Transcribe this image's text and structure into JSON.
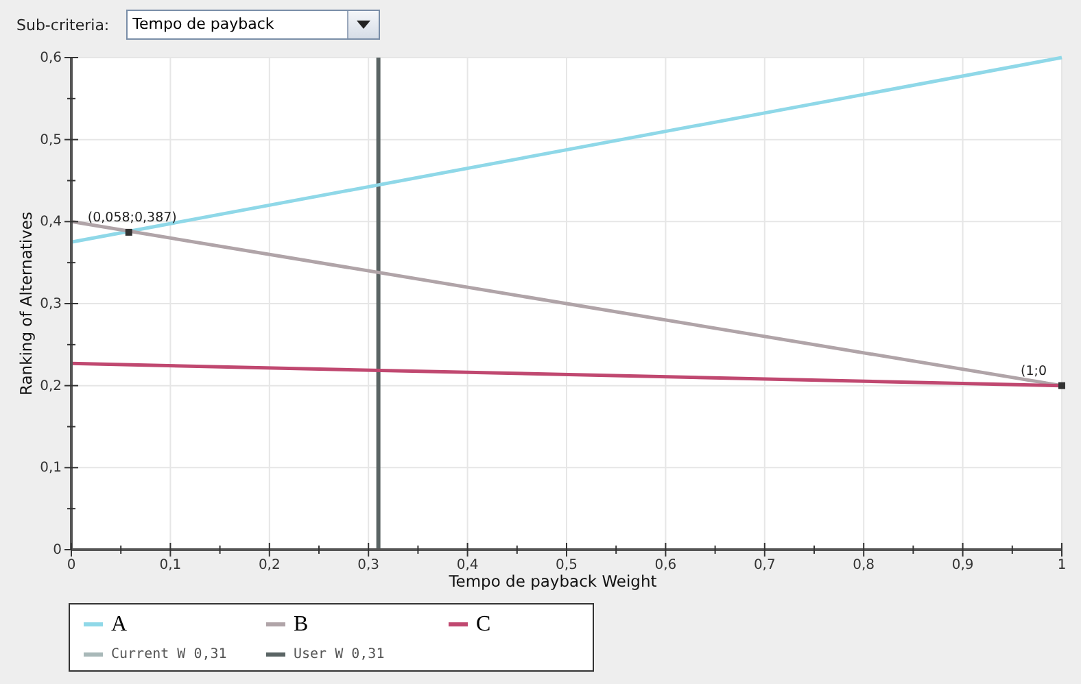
{
  "sub_criteria": {
    "label": "Sub-criteria:",
    "value": "Tempo de payback"
  },
  "chart": {
    "chart_data": {
      "type": "line",
      "xlabel": "Tempo de payback Weight",
      "ylabel": "Ranking of Alternatives",
      "xlim": [
        0,
        1
      ],
      "ylim": [
        0,
        0.6
      ],
      "grid": true,
      "xticks": [
        {
          "value": 0,
          "label": "0"
        },
        {
          "value": 0.1,
          "label": "0,1"
        },
        {
          "value": 0.2,
          "label": "0,2"
        },
        {
          "value": 0.3,
          "label": "0,3"
        },
        {
          "value": 0.4,
          "label": "0,4"
        },
        {
          "value": 0.5,
          "label": "0,5"
        },
        {
          "value": 0.6,
          "label": "0,6"
        },
        {
          "value": 0.7,
          "label": "0,7"
        },
        {
          "value": 0.8,
          "label": "0,8"
        },
        {
          "value": 0.9,
          "label": "0,9"
        },
        {
          "value": 1,
          "label": "1"
        }
      ],
      "yticks": [
        {
          "value": 0,
          "label": "0"
        },
        {
          "value": 0.1,
          "label": "0,1"
        },
        {
          "value": 0.2,
          "label": "0,2"
        },
        {
          "value": 0.3,
          "label": "0,3"
        },
        {
          "value": 0.4,
          "label": "0,4"
        },
        {
          "value": 0.5,
          "label": "0,5"
        },
        {
          "value": 0.6,
          "label": "0,6"
        }
      ],
      "x": [
        0,
        1
      ],
      "series": [
        {
          "name": "A",
          "color": "#8fd8e8",
          "values": [
            0.375,
            0.6
          ]
        },
        {
          "name": "B",
          "color": "#b0a4a8",
          "values": [
            0.4,
            0.2
          ]
        },
        {
          "name": "C",
          "color": "#c04870",
          "values": [
            0.227,
            0.2
          ]
        }
      ],
      "ref_lines": [
        {
          "axis": "x",
          "value": 0.31,
          "color": "#5a6464"
        }
      ],
      "annotations": [
        {
          "text": "(0,058;0,387)",
          "x": 0.058,
          "y": 0.387
        },
        {
          "text": "(1;0",
          "x": 1,
          "y": 0.2
        }
      ]
    }
  },
  "legend_extra": [
    {
      "label": "Current W 0,31",
      "color": "#a8b8b8"
    },
    {
      "label": "User W 0,31",
      "color": "#5a6464"
    }
  ]
}
